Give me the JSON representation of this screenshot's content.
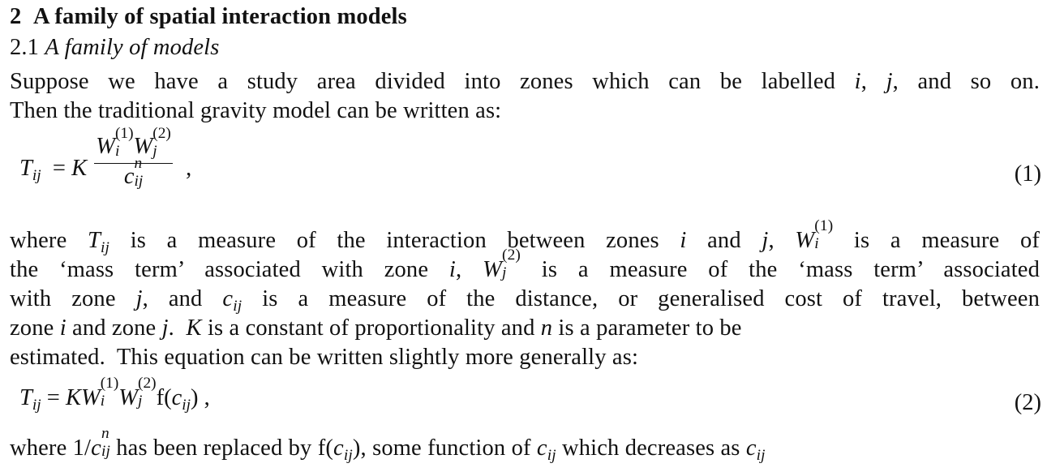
{
  "section": {
    "number": "2",
    "title": "A family of spatial interaction models"
  },
  "subsection": {
    "number": "2.1",
    "title": "A family of models"
  },
  "paragraph1": {
    "line1_a": "Suppose we have a study area divided into zones which can be labelled ",
    "var_i": "i",
    "sep1": ", ",
    "var_j": "j",
    "line1_b": ", and so on.",
    "line2": "Then the traditional gravity model can be written as:"
  },
  "equation1": {
    "lhs": "T",
    "lhs_sub": "ij",
    "equals": "=",
    "constant": "K",
    "num_w1": "W",
    "num_w1_sub": "i",
    "num_w1_sup": "(1)",
    "num_w2": "W",
    "num_w2_sub": "j",
    "num_w2_sup": "(2)",
    "den_c": "c",
    "den_c_sub": "ij",
    "den_c_sup": "n",
    "trail": ",",
    "number": "(1)"
  },
  "paragraph2": {
    "l1_a": "where ",
    "l1_T": "T",
    "l1_T_sub": "ij",
    "l1_b": " is a measure of the interaction between zones ",
    "l1_i": "i",
    "l1_c": " and ",
    "l1_j": "j",
    "l1_d": ", ",
    "l1_W": "W",
    "l1_W_sub": "i",
    "l1_W_sup": "(1)",
    "l1_e": " is a measure of",
    "l2_a": "the ‘mass term’ associated with zone ",
    "l2_i": "i",
    "l2_b": ", ",
    "l2_W": "W",
    "l2_W_sub": "j",
    "l2_W_sup": "(2)",
    "l2_c": " is a measure of the ‘mass term’ associated",
    "l3_a": "with zone ",
    "l3_j": "j",
    "l3_b": ", and ",
    "l3_c": "c",
    "l3_c_sub": "ij",
    "l3_d": " is a measure of the distance, or generalised cost of travel, between",
    "l4_a": "zone ",
    "l4_i": "i",
    "l4_b": " and zone ",
    "l4_j": "j",
    "l4_c": ".  ",
    "l4_K": "K",
    "l4_d": " is a constant of proportionality and ",
    "l4_n": "n",
    "l4_e": " is a parameter to be",
    "l5": "estimated.  This equation can be written slightly more generally as:"
  },
  "equation2": {
    "lhs": "T",
    "lhs_sub": "ij",
    "equals": "=",
    "constant": "K",
    "w1": "W",
    "w1_sub": "i",
    "w1_sup": "(1)",
    "w2": "W",
    "w2_sub": "j",
    "w2_sup": "(2)",
    "f": "f(",
    "c": "c",
    "c_sub": "ij",
    "close": ")",
    "trail": " ,",
    "number": "(2)"
  },
  "paragraph3": {
    "a": "where 1/",
    "c1": "c",
    "c1_sub": "ij",
    "c1_sup": "n",
    "b": " has been replaced by f(",
    "c2": "c",
    "c2_sub": "ij",
    "c": "), some function of ",
    "c3": "c",
    "c3_sub": "ij",
    "d": " which decreases as ",
    "c4": "c",
    "c4_sub": "ij"
  }
}
